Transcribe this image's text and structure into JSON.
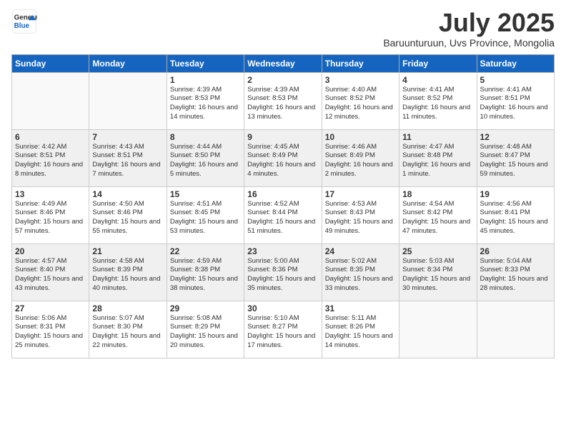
{
  "logo": {
    "general": "General",
    "blue": "Blue"
  },
  "title": "July 2025",
  "subtitle": "Baruunturuun, Uvs Province, Mongolia",
  "days_of_week": [
    "Sunday",
    "Monday",
    "Tuesday",
    "Wednesday",
    "Thursday",
    "Friday",
    "Saturday"
  ],
  "weeks": [
    [
      {
        "day": "",
        "sunrise": "",
        "sunset": "",
        "daylight": ""
      },
      {
        "day": "",
        "sunrise": "",
        "sunset": "",
        "daylight": ""
      },
      {
        "day": "1",
        "sunrise": "Sunrise: 4:39 AM",
        "sunset": "Sunset: 8:53 PM",
        "daylight": "Daylight: 16 hours and 14 minutes."
      },
      {
        "day": "2",
        "sunrise": "Sunrise: 4:39 AM",
        "sunset": "Sunset: 8:53 PM",
        "daylight": "Daylight: 16 hours and 13 minutes."
      },
      {
        "day": "3",
        "sunrise": "Sunrise: 4:40 AM",
        "sunset": "Sunset: 8:52 PM",
        "daylight": "Daylight: 16 hours and 12 minutes."
      },
      {
        "day": "4",
        "sunrise": "Sunrise: 4:41 AM",
        "sunset": "Sunset: 8:52 PM",
        "daylight": "Daylight: 16 hours and 11 minutes."
      },
      {
        "day": "5",
        "sunrise": "Sunrise: 4:41 AM",
        "sunset": "Sunset: 8:51 PM",
        "daylight": "Daylight: 16 hours and 10 minutes."
      }
    ],
    [
      {
        "day": "6",
        "sunrise": "Sunrise: 4:42 AM",
        "sunset": "Sunset: 8:51 PM",
        "daylight": "Daylight: 16 hours and 8 minutes."
      },
      {
        "day": "7",
        "sunrise": "Sunrise: 4:43 AM",
        "sunset": "Sunset: 8:51 PM",
        "daylight": "Daylight: 16 hours and 7 minutes."
      },
      {
        "day": "8",
        "sunrise": "Sunrise: 4:44 AM",
        "sunset": "Sunset: 8:50 PM",
        "daylight": "Daylight: 16 hours and 5 minutes."
      },
      {
        "day": "9",
        "sunrise": "Sunrise: 4:45 AM",
        "sunset": "Sunset: 8:49 PM",
        "daylight": "Daylight: 16 hours and 4 minutes."
      },
      {
        "day": "10",
        "sunrise": "Sunrise: 4:46 AM",
        "sunset": "Sunset: 8:49 PM",
        "daylight": "Daylight: 16 hours and 2 minutes."
      },
      {
        "day": "11",
        "sunrise": "Sunrise: 4:47 AM",
        "sunset": "Sunset: 8:48 PM",
        "daylight": "Daylight: 16 hours and 1 minute."
      },
      {
        "day": "12",
        "sunrise": "Sunrise: 4:48 AM",
        "sunset": "Sunset: 8:47 PM",
        "daylight": "Daylight: 15 hours and 59 minutes."
      }
    ],
    [
      {
        "day": "13",
        "sunrise": "Sunrise: 4:49 AM",
        "sunset": "Sunset: 8:46 PM",
        "daylight": "Daylight: 15 hours and 57 minutes."
      },
      {
        "day": "14",
        "sunrise": "Sunrise: 4:50 AM",
        "sunset": "Sunset: 8:46 PM",
        "daylight": "Daylight: 15 hours and 55 minutes."
      },
      {
        "day": "15",
        "sunrise": "Sunrise: 4:51 AM",
        "sunset": "Sunset: 8:45 PM",
        "daylight": "Daylight: 15 hours and 53 minutes."
      },
      {
        "day": "16",
        "sunrise": "Sunrise: 4:52 AM",
        "sunset": "Sunset: 8:44 PM",
        "daylight": "Daylight: 15 hours and 51 minutes."
      },
      {
        "day": "17",
        "sunrise": "Sunrise: 4:53 AM",
        "sunset": "Sunset: 8:43 PM",
        "daylight": "Daylight: 15 hours and 49 minutes."
      },
      {
        "day": "18",
        "sunrise": "Sunrise: 4:54 AM",
        "sunset": "Sunset: 8:42 PM",
        "daylight": "Daylight: 15 hours and 47 minutes."
      },
      {
        "day": "19",
        "sunrise": "Sunrise: 4:56 AM",
        "sunset": "Sunset: 8:41 PM",
        "daylight": "Daylight: 15 hours and 45 minutes."
      }
    ],
    [
      {
        "day": "20",
        "sunrise": "Sunrise: 4:57 AM",
        "sunset": "Sunset: 8:40 PM",
        "daylight": "Daylight: 15 hours and 43 minutes."
      },
      {
        "day": "21",
        "sunrise": "Sunrise: 4:58 AM",
        "sunset": "Sunset: 8:39 PM",
        "daylight": "Daylight: 15 hours and 40 minutes."
      },
      {
        "day": "22",
        "sunrise": "Sunrise: 4:59 AM",
        "sunset": "Sunset: 8:38 PM",
        "daylight": "Daylight: 15 hours and 38 minutes."
      },
      {
        "day": "23",
        "sunrise": "Sunrise: 5:00 AM",
        "sunset": "Sunset: 8:36 PM",
        "daylight": "Daylight: 15 hours and 35 minutes."
      },
      {
        "day": "24",
        "sunrise": "Sunrise: 5:02 AM",
        "sunset": "Sunset: 8:35 PM",
        "daylight": "Daylight: 15 hours and 33 minutes."
      },
      {
        "day": "25",
        "sunrise": "Sunrise: 5:03 AM",
        "sunset": "Sunset: 8:34 PM",
        "daylight": "Daylight: 15 hours and 30 minutes."
      },
      {
        "day": "26",
        "sunrise": "Sunrise: 5:04 AM",
        "sunset": "Sunset: 8:33 PM",
        "daylight": "Daylight: 15 hours and 28 minutes."
      }
    ],
    [
      {
        "day": "27",
        "sunrise": "Sunrise: 5:06 AM",
        "sunset": "Sunset: 8:31 PM",
        "daylight": "Daylight: 15 hours and 25 minutes."
      },
      {
        "day": "28",
        "sunrise": "Sunrise: 5:07 AM",
        "sunset": "Sunset: 8:30 PM",
        "daylight": "Daylight: 15 hours and 22 minutes."
      },
      {
        "day": "29",
        "sunrise": "Sunrise: 5:08 AM",
        "sunset": "Sunset: 8:29 PM",
        "daylight": "Daylight: 15 hours and 20 minutes."
      },
      {
        "day": "30",
        "sunrise": "Sunrise: 5:10 AM",
        "sunset": "Sunset: 8:27 PM",
        "daylight": "Daylight: 15 hours and 17 minutes."
      },
      {
        "day": "31",
        "sunrise": "Sunrise: 5:11 AM",
        "sunset": "Sunset: 8:26 PM",
        "daylight": "Daylight: 15 hours and 14 minutes."
      },
      {
        "day": "",
        "sunrise": "",
        "sunset": "",
        "daylight": ""
      },
      {
        "day": "",
        "sunrise": "",
        "sunset": "",
        "daylight": ""
      }
    ]
  ]
}
